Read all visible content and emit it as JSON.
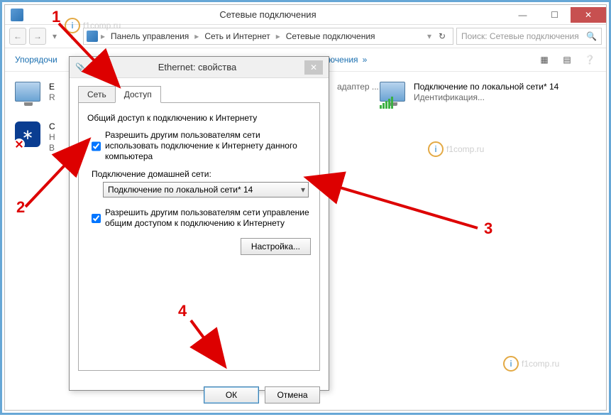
{
  "window": {
    "title": "Сетевые подключения",
    "breadcrumbs": [
      "Панель управления",
      "Сеть и Интернет",
      "Сетевые подключения"
    ],
    "search_placeholder": "Поиск: Сетевые подключения"
  },
  "toolbar": {
    "organize": "Упорядочи",
    "subtitle": "ключения"
  },
  "adapters": [
    {
      "name": "E",
      "line2": "",
      "line3": "R"
    },
    {
      "name": "С",
      "line2": "Н",
      "line3": "B"
    },
    {
      "name": "адаптер ...",
      "line2": ""
    },
    {
      "name": "Подключение по локальной сети* 14",
      "line2": "Идентификация..."
    }
  ],
  "dialog": {
    "title": "Ethernet: свойства",
    "tabs": {
      "network": "Сеть",
      "sharing": "Доступ"
    },
    "group_title": "Общий доступ к подключению к Интернету",
    "allow_share": "Разрешить другим пользователям сети использовать подключение к Интернету данного компьютера",
    "home_label": "Подключение домашней сети:",
    "home_value": "Подключение по локальной сети* 14",
    "allow_control": "Разрешить другим пользователям сети управление общим доступом к подключению к Интернету",
    "settings_btn": "Настройка...",
    "ok": "ОК",
    "cancel": "Отмена"
  },
  "annotations": {
    "n1": "1",
    "n2": "2",
    "n3": "3",
    "n4": "4"
  },
  "watermark": "f1comp.ru"
}
